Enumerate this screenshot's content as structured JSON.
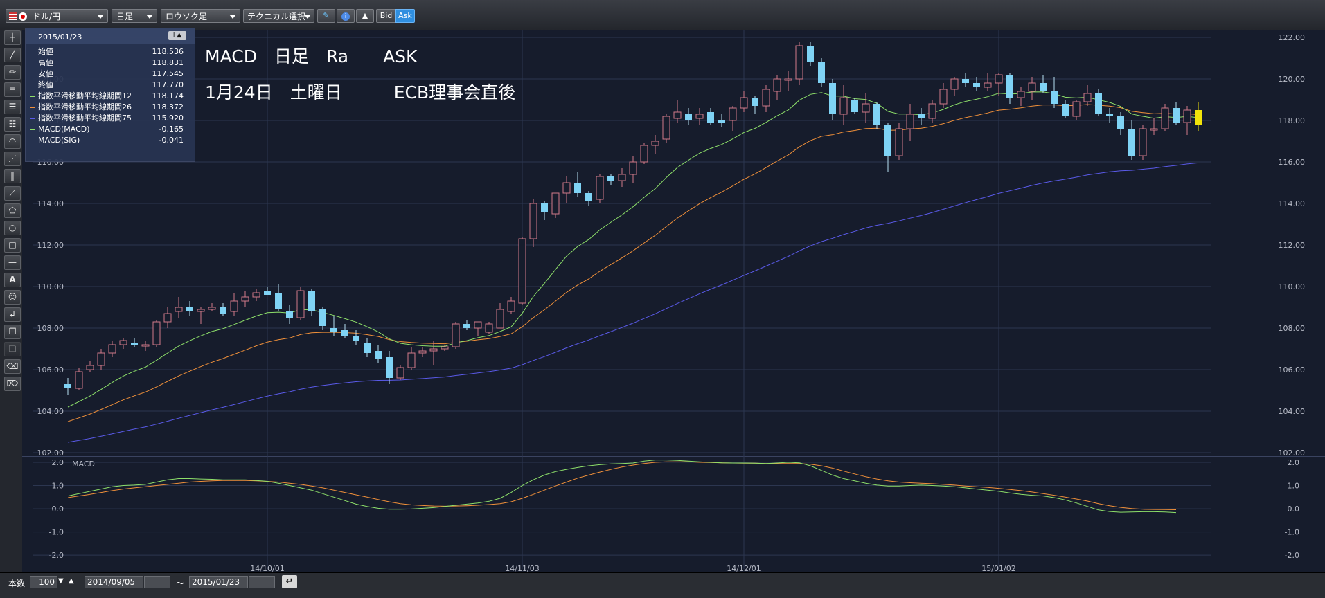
{
  "toolbar": {
    "currency_pair": "ドル/円",
    "period": "日足",
    "chart_type": "ロウソク足",
    "technical": "テクニカル選択",
    "bid_label": "Bid",
    "ask_label": "Ask"
  },
  "info_panel": {
    "date": "2015/01/23",
    "rows": [
      {
        "label": "始値",
        "value": "118.536",
        "color": ""
      },
      {
        "label": "高値",
        "value": "118.831",
        "color": ""
      },
      {
        "label": "安値",
        "value": "117.545",
        "color": ""
      },
      {
        "label": "終値",
        "value": "117.770",
        "color": ""
      },
      {
        "label": "指数平滑移動平均線期間12",
        "value": "118.174",
        "color": "#8ee06a"
      },
      {
        "label": "指数平滑移動平均線期間26",
        "value": "118.372",
        "color": "#f0903a"
      },
      {
        "label": "指数平滑移動平均線期間75",
        "value": "115.920",
        "color": "#5a5ae8"
      },
      {
        "label": "MACD(MACD)",
        "value": "-0.165",
        "color": "#8ee06a"
      },
      {
        "label": "MACD(SIG)",
        "value": "-0.041",
        "color": "#f0903a"
      }
    ]
  },
  "annotation": {
    "line1": "MACD　日足　Ra　　ASK",
    "line2": "1月24日　土曜日　　　ECB理事会直後"
  },
  "colors": {
    "bull": "#d27a8a",
    "bear": "#7fd3f5",
    "ema12": "#8ee06a",
    "ema26": "#f0903a",
    "ema75": "#5a5ae8",
    "last": "#f2e30a",
    "grid": "#2c3650",
    "axis_text": "#b8bcc8"
  },
  "bottom": {
    "count_label": "本数",
    "count_value": "100",
    "start_date": "2014/09/05",
    "tilde": "〜",
    "end_date": "2015/01/23"
  },
  "chart_data": [
    {
      "type": "candlestick",
      "title": "",
      "ylim": [
        102.0,
        122.0
      ],
      "y_ticks": [
        "122.00",
        "120.00",
        "118.00",
        "116.00",
        "114.00",
        "112.00",
        "110.00",
        "108.00",
        "106.00",
        "104.00",
        "102.00"
      ],
      "x_tick_labels": [
        {
          "index": 18,
          "label": "14/10/01"
        },
        {
          "index": 41,
          "label": "14/11/03"
        },
        {
          "index": 61,
          "label": "14/12/01"
        },
        {
          "index": 84,
          "label": "15/01/02"
        }
      ],
      "ohlc": [
        [
          105.3,
          105.6,
          104.8,
          105.1
        ],
        [
          105.1,
          106.1,
          105.0,
          105.9
        ],
        [
          106.0,
          106.4,
          105.9,
          106.2
        ],
        [
          106.2,
          107.0,
          106.0,
          106.8
        ],
        [
          106.8,
          107.4,
          106.6,
          107.2
        ],
        [
          107.2,
          107.5,
          107.0,
          107.4
        ],
        [
          107.3,
          107.5,
          107.1,
          107.2
        ],
        [
          107.2,
          107.4,
          106.9,
          107.2
        ],
        [
          107.2,
          108.4,
          107.1,
          108.3
        ],
        [
          108.3,
          109.0,
          108.0,
          108.7
        ],
        [
          108.8,
          109.5,
          108.5,
          109.0
        ],
        [
          109.0,
          109.3,
          108.6,
          108.8
        ],
        [
          108.8,
          109.0,
          108.2,
          108.9
        ],
        [
          108.9,
          109.2,
          108.8,
          109.0
        ],
        [
          109.0,
          109.2,
          108.6,
          108.7
        ],
        [
          108.8,
          109.7,
          108.6,
          109.3
        ],
        [
          109.3,
          109.8,
          109.0,
          109.5
        ],
        [
          109.5,
          109.9,
          109.3,
          109.7
        ],
        [
          109.8,
          110.0,
          109.6,
          109.6
        ],
        [
          109.7,
          110.1,
          108.8,
          108.9
        ],
        [
          108.8,
          109.1,
          108.2,
          108.5
        ],
        [
          108.5,
          110.0,
          108.4,
          109.8
        ],
        [
          109.8,
          109.9,
          108.6,
          108.8
        ],
        [
          108.9,
          109.0,
          107.9,
          108.1
        ],
        [
          108.0,
          108.6,
          107.6,
          107.8
        ],
        [
          107.9,
          108.2,
          107.5,
          107.6
        ],
        [
          107.6,
          107.9,
          107.2,
          107.4
        ],
        [
          107.3,
          107.5,
          106.6,
          106.8
        ],
        [
          106.9,
          107.2,
          106.3,
          106.5
        ],
        [
          106.6,
          106.9,
          105.3,
          105.6
        ],
        [
          105.6,
          106.2,
          105.5,
          106.1
        ],
        [
          106.1,
          107.1,
          106.0,
          106.8
        ],
        [
          106.8,
          107.1,
          106.6,
          106.9
        ],
        [
          106.9,
          107.4,
          106.2,
          107.0
        ],
        [
          107.0,
          107.2,
          106.9,
          107.1
        ],
        [
          107.1,
          108.3,
          107.0,
          108.2
        ],
        [
          108.2,
          108.4,
          107.9,
          108.0
        ],
        [
          108.0,
          108.3,
          107.6,
          108.3
        ],
        [
          107.8,
          108.3,
          107.7,
          108.2
        ],
        [
          108.0,
          109.2,
          108.0,
          108.9
        ],
        [
          108.8,
          109.5,
          108.7,
          109.3
        ],
        [
          109.2,
          112.4,
          109.1,
          112.3
        ],
        [
          112.3,
          114.2,
          111.9,
          114.0
        ],
        [
          114.0,
          114.1,
          113.2,
          113.6
        ],
        [
          113.5,
          114.5,
          113.3,
          114.5
        ],
        [
          114.5,
          115.3,
          114.0,
          115.0
        ],
        [
          115.0,
          115.5,
          114.3,
          114.5
        ],
        [
          114.5,
          114.6,
          113.9,
          114.1
        ],
        [
          114.2,
          115.4,
          114.0,
          115.3
        ],
        [
          115.3,
          115.4,
          114.9,
          115.1
        ],
        [
          115.1,
          115.7,
          114.8,
          115.4
        ],
        [
          115.4,
          116.3,
          115.0,
          116.0
        ],
        [
          116.0,
          116.9,
          115.9,
          116.8
        ],
        [
          116.8,
          117.3,
          116.4,
          117.0
        ],
        [
          117.1,
          118.3,
          116.9,
          118.2
        ],
        [
          118.1,
          119.0,
          117.9,
          118.4
        ],
        [
          118.3,
          118.6,
          117.8,
          118.0
        ],
        [
          118.1,
          118.6,
          117.8,
          118.3
        ],
        [
          118.4,
          118.6,
          117.8,
          117.9
        ],
        [
          118.0,
          118.3,
          117.7,
          117.9
        ],
        [
          118.0,
          118.7,
          117.5,
          118.6
        ],
        [
          118.6,
          119.4,
          118.4,
          119.1
        ],
        [
          119.1,
          119.2,
          118.3,
          118.7
        ],
        [
          118.7,
          119.7,
          118.4,
          119.5
        ],
        [
          119.4,
          120.2,
          119.0,
          120.0
        ],
        [
          120.0,
          120.4,
          119.4,
          120.0
        ],
        [
          120.0,
          121.8,
          119.7,
          121.6
        ],
        [
          121.6,
          121.8,
          120.6,
          120.8
        ],
        [
          120.8,
          121.0,
          119.6,
          119.8
        ],
        [
          119.8,
          120.0,
          118.0,
          118.3
        ],
        [
          118.3,
          119.7,
          117.8,
          119.1
        ],
        [
          119.0,
          119.1,
          118.3,
          118.4
        ],
        [
          118.4,
          119.3,
          117.9,
          118.8
        ],
        [
          118.8,
          118.9,
          117.6,
          117.8
        ],
        [
          117.8,
          117.9,
          115.5,
          116.3
        ],
        [
          116.3,
          117.9,
          116.1,
          117.6
        ],
        [
          117.6,
          118.8,
          117.0,
          118.3
        ],
        [
          118.3,
          118.6,
          117.8,
          118.1
        ],
        [
          118.1,
          119.0,
          117.9,
          118.8
        ],
        [
          118.8,
          119.8,
          118.6,
          119.5
        ],
        [
          119.5,
          120.1,
          119.2,
          120.0
        ],
        [
          120.0,
          120.3,
          119.6,
          119.8
        ],
        [
          119.8,
          120.1,
          119.4,
          119.6
        ],
        [
          119.6,
          120.3,
          119.4,
          119.8
        ],
        [
          119.8,
          120.3,
          119.2,
          120.2
        ],
        [
          120.2,
          120.3,
          118.8,
          119.1
        ],
        [
          119.1,
          119.6,
          118.7,
          119.4
        ],
        [
          119.4,
          120.1,
          119.0,
          119.8
        ],
        [
          119.8,
          120.2,
          119.3,
          119.4
        ],
        [
          119.4,
          120.1,
          118.6,
          118.8
        ],
        [
          118.8,
          119.0,
          118.1,
          118.2
        ],
        [
          118.2,
          119.0,
          118.0,
          118.9
        ],
        [
          118.9,
          119.7,
          118.7,
          119.3
        ],
        [
          119.3,
          119.5,
          118.2,
          118.3
        ],
        [
          118.3,
          118.6,
          117.9,
          118.2
        ],
        [
          118.2,
          118.4,
          117.3,
          117.6
        ],
        [
          117.6,
          118.0,
          116.1,
          116.3
        ],
        [
          116.3,
          117.8,
          116.1,
          117.6
        ],
        [
          117.6,
          118.1,
          117.3,
          117.6
        ],
        [
          117.6,
          118.8,
          117.5,
          118.6
        ],
        [
          118.6,
          118.9,
          117.8,
          117.9
        ],
        [
          117.9,
          118.7,
          117.3,
          118.5
        ],
        [
          118.5,
          118.9,
          117.5,
          117.8
        ]
      ],
      "series": [
        {
          "name": "指数平滑移動平均線期間12",
          "ema_period": 12
        },
        {
          "name": "指数平滑移動平均線期間26",
          "ema_period": 26
        },
        {
          "name": "指数平滑移動平均線期間75",
          "ema_period": 75
        }
      ]
    },
    {
      "type": "line",
      "title": "MACD",
      "ylim": [
        -2.0,
        2.0
      ],
      "y_ticks": [
        "2.0",
        "1.0",
        "0.0",
        "-1.0",
        "-2.0"
      ],
      "series": [
        {
          "name": "MACD(MACD)",
          "values": [
            0.55,
            0.65,
            0.75,
            0.85,
            0.95,
            1.0,
            1.02,
            1.05,
            1.15,
            1.25,
            1.3,
            1.3,
            1.28,
            1.27,
            1.25,
            1.25,
            1.25,
            1.22,
            1.18,
            1.1,
            1.0,
            0.9,
            0.8,
            0.65,
            0.5,
            0.35,
            0.2,
            0.1,
            0.02,
            -0.02,
            -0.02,
            -0.01,
            0.02,
            0.05,
            0.1,
            0.15,
            0.2,
            0.25,
            0.32,
            0.45,
            0.7,
            1.0,
            1.25,
            1.45,
            1.6,
            1.7,
            1.78,
            1.85,
            1.9,
            1.93,
            1.95,
            1.97,
            2.05,
            2.1,
            2.1,
            2.08,
            2.05,
            2.02,
            2.0,
            1.98,
            1.97,
            1.97,
            1.96,
            1.95,
            1.97,
            2.0,
            1.98,
            1.85,
            1.65,
            1.45,
            1.3,
            1.2,
            1.1,
            1.02,
            0.98,
            0.98,
            1.0,
            1.02,
            1.0,
            0.98,
            0.95,
            0.9,
            0.85,
            0.8,
            0.75,
            0.68,
            0.62,
            0.58,
            0.55,
            0.48,
            0.38,
            0.25,
            0.1,
            -0.05,
            -0.12,
            -0.15,
            -0.14,
            -0.13,
            -0.13,
            -0.14,
            -0.165
          ]
        },
        {
          "name": "MACD(SIG)",
          "values": [
            0.48,
            0.55,
            0.62,
            0.7,
            0.78,
            0.85,
            0.9,
            0.95,
            1.0,
            1.05,
            1.1,
            1.15,
            1.18,
            1.2,
            1.22,
            1.22,
            1.22,
            1.2,
            1.18,
            1.15,
            1.1,
            1.05,
            0.98,
            0.9,
            0.8,
            0.7,
            0.6,
            0.5,
            0.4,
            0.3,
            0.22,
            0.17,
            0.14,
            0.12,
            0.11,
            0.12,
            0.13,
            0.15,
            0.18,
            0.22,
            0.3,
            0.45,
            0.62,
            0.8,
            0.98,
            1.15,
            1.32,
            1.45,
            1.58,
            1.7,
            1.8,
            1.88,
            1.95,
            2.0,
            2.02,
            2.02,
            2.02,
            2.0,
            1.99,
            1.98,
            1.97,
            1.96,
            1.96,
            1.95,
            1.95,
            1.95,
            1.95,
            1.92,
            1.85,
            1.75,
            1.62,
            1.5,
            1.38,
            1.28,
            1.2,
            1.15,
            1.12,
            1.1,
            1.08,
            1.05,
            1.02,
            0.98,
            0.95,
            0.92,
            0.88,
            0.83,
            0.78,
            0.72,
            0.65,
            0.58,
            0.5,
            0.42,
            0.33,
            0.22,
            0.13,
            0.06,
            0.01,
            -0.02,
            -0.03,
            -0.035,
            -0.041
          ]
        }
      ]
    }
  ]
}
